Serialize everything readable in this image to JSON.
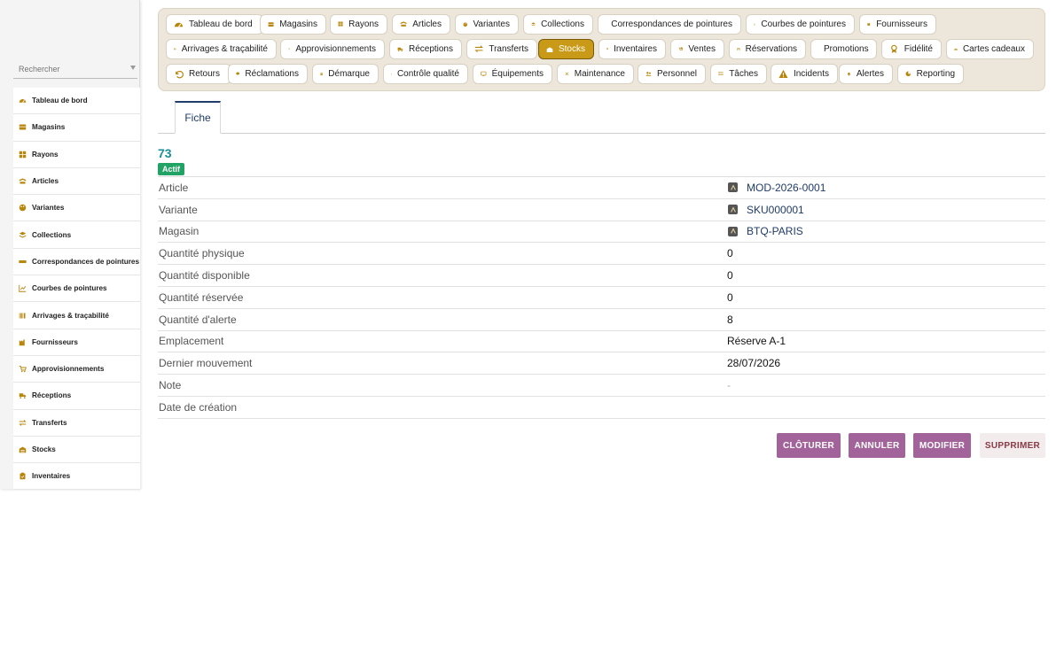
{
  "sidebar": {
    "search_placeholder": "Rechercher",
    "items": [
      {
        "label": "Tableau de bord",
        "icon": "dashboard-icon"
      },
      {
        "label": "Magasins",
        "icon": "store-icon"
      },
      {
        "label": "Rayons",
        "icon": "grid-icon"
      },
      {
        "label": "Articles",
        "icon": "tag-icon"
      },
      {
        "label": "Variantes",
        "icon": "palette-icon"
      },
      {
        "label": "Collections",
        "icon": "layers-icon"
      },
      {
        "label": "Correspondances de pointures",
        "icon": "ruler-icon"
      },
      {
        "label": "Courbes de pointures",
        "icon": "chart-icon"
      },
      {
        "label": "Arrivages & traçabilité",
        "icon": "barcode-icon"
      },
      {
        "label": "Fournisseurs",
        "icon": "factory-icon"
      },
      {
        "label": "Approvisionnements",
        "icon": "cart-icon"
      },
      {
        "label": "Réceptions",
        "icon": "truck-icon"
      },
      {
        "label": "Transferts",
        "icon": "arrows-icon"
      },
      {
        "label": "Stocks",
        "icon": "warehouse-icon"
      },
      {
        "label": "Inventaires",
        "icon": "clipboard-icon"
      }
    ]
  },
  "topnav": {
    "items": [
      {
        "label": "Tableau de bord",
        "icon": "dashboard-icon"
      },
      {
        "label": "Magasins",
        "icon": "store-icon"
      },
      {
        "label": "Rayons",
        "icon": "grid-icon"
      },
      {
        "label": "Articles",
        "icon": "tag-icon"
      },
      {
        "label": "Variantes",
        "icon": "palette-icon"
      },
      {
        "label": "Collections",
        "icon": "layers-icon"
      },
      {
        "label": "Correspondances de pointures",
        "icon": "ruler-icon"
      },
      {
        "label": "Courbes de pointures",
        "icon": "chart-icon"
      },
      {
        "label": "Fournisseurs",
        "icon": "factory-icon"
      },
      {
        "label": "Arrivages & traçabilité",
        "icon": "barcode-icon"
      },
      {
        "label": "Approvisionnements",
        "icon": "cart-icon"
      },
      {
        "label": "Réceptions",
        "icon": "truck-icon"
      },
      {
        "label": "Transferts",
        "icon": "arrows-icon"
      },
      {
        "label": "Stocks",
        "icon": "warehouse-icon",
        "active": true
      },
      {
        "label": "Inventaires",
        "icon": "clipboard-icon"
      },
      {
        "label": "Ventes",
        "icon": "sales-icon"
      },
      {
        "label": "Réservations",
        "icon": "calendar-icon"
      },
      {
        "label": "Promotions",
        "icon": "promo-tag-icon"
      },
      {
        "label": "Fidélité",
        "icon": "medal-icon"
      },
      {
        "label": "Cartes cadeaux",
        "icon": "gift-icon"
      },
      {
        "label": "Retours",
        "icon": "undo-icon"
      },
      {
        "label": "Réclamations",
        "icon": "chat-icon"
      },
      {
        "label": "Démarque",
        "icon": "document-icon"
      },
      {
        "label": "Contrôle qualité",
        "icon": "checklist-icon"
      },
      {
        "label": "Équipements",
        "icon": "monitor-icon"
      },
      {
        "label": "Maintenance",
        "icon": "tools-icon"
      },
      {
        "label": "Personnel",
        "icon": "people-icon"
      },
      {
        "label": "Tâches",
        "icon": "tasks-icon"
      },
      {
        "label": "Incidents",
        "icon": "warning-icon"
      },
      {
        "label": "Alertes",
        "icon": "bell-icon"
      },
      {
        "label": "Reporting",
        "icon": "pie-icon"
      }
    ]
  },
  "tabs": [
    {
      "label": "Fiche"
    }
  ],
  "record": {
    "id": "73",
    "status": "Actif",
    "fields": [
      {
        "label": "Article",
        "value": "MOD-2026-0001",
        "type": "link"
      },
      {
        "label": "Variante",
        "value": "SKU000001",
        "type": "link"
      },
      {
        "label": "Magasin",
        "value": "BTQ-PARIS",
        "type": "link"
      },
      {
        "label": "Quantité physique",
        "value": "0"
      },
      {
        "label": "Quantité disponible",
        "value": "0"
      },
      {
        "label": "Quantité réservée",
        "value": "0"
      },
      {
        "label": "Quantité d'alerte",
        "value": "8"
      },
      {
        "label": "Emplacement",
        "value": "Réserve A-1"
      },
      {
        "label": "Dernier mouvement",
        "value": "28/07/2026"
      },
      {
        "label": "Note",
        "value": "-",
        "type": "dash"
      },
      {
        "label": "Date de création",
        "value": ""
      }
    ]
  },
  "actions": {
    "close": "CLÔTURER",
    "cancel": "ANNULER",
    "edit": "MODIFIER",
    "delete": "SUPPRIMER"
  },
  "colors": {
    "accent_gold": "#c99a17",
    "teal_id": "#1a8e97",
    "status_green": "#20a365",
    "action_purple": "#a2639a",
    "link_navy": "#1f3c6a"
  }
}
